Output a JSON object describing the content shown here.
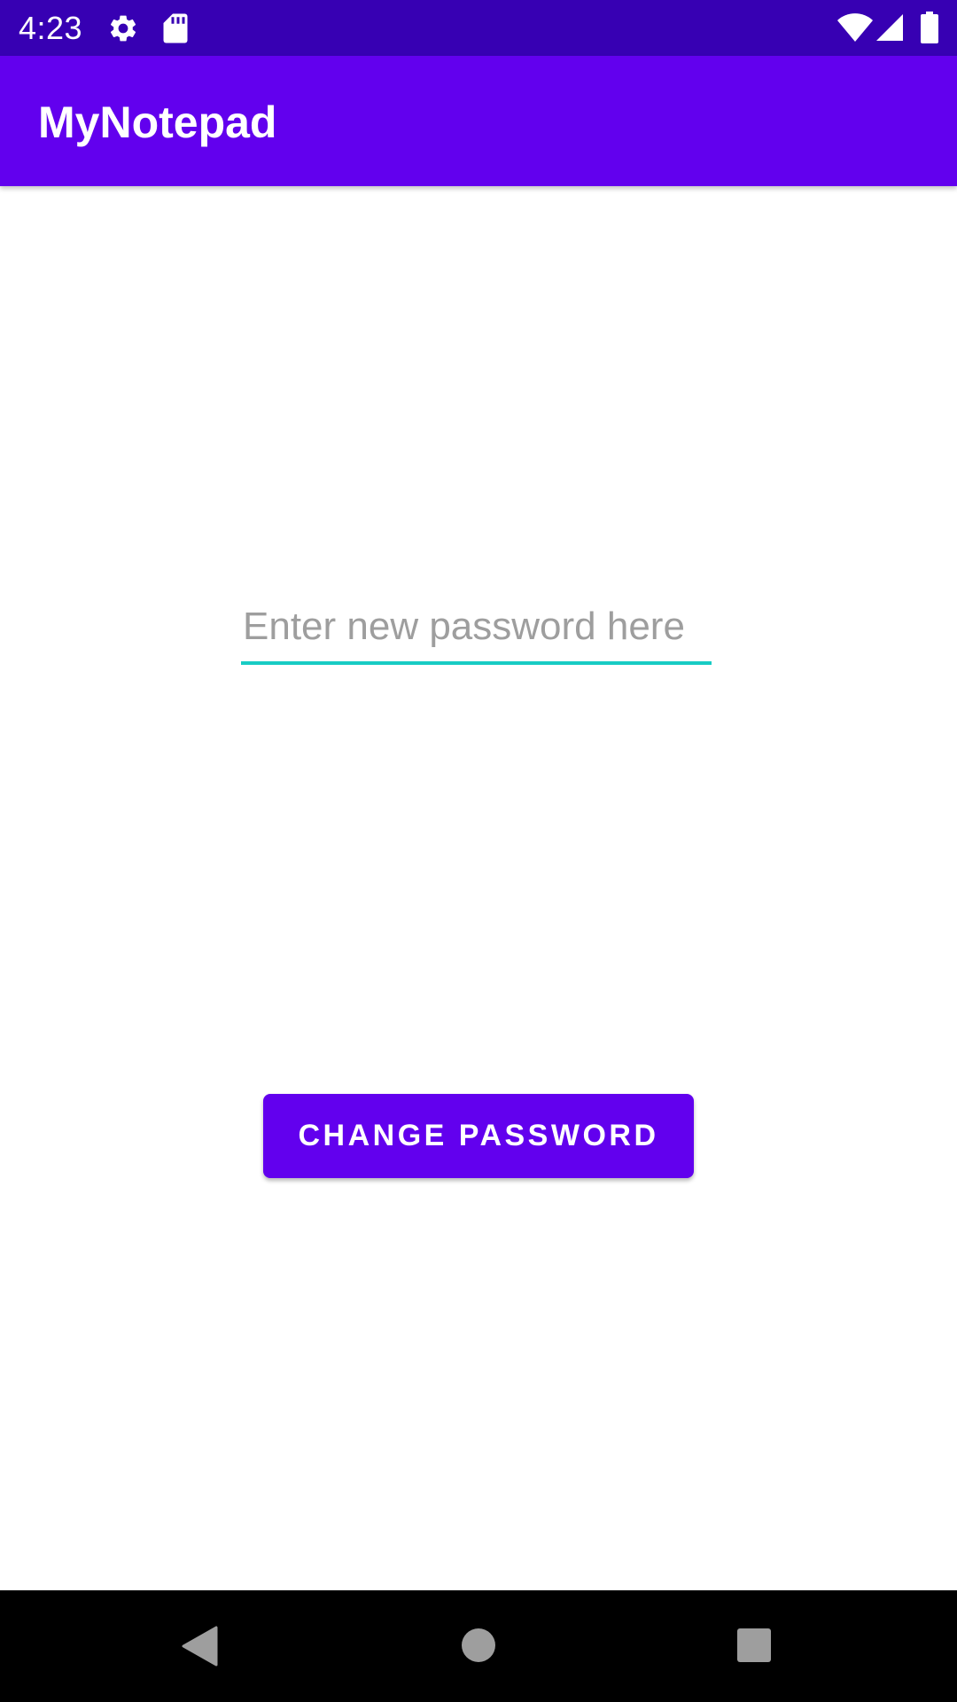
{
  "status_bar": {
    "time": "4:23",
    "icons": [
      "settings-icon",
      "sd-card-icon",
      "wifi-icon",
      "cell-signal-icon",
      "battery-icon"
    ]
  },
  "app_bar": {
    "title": "MyNotepad"
  },
  "form": {
    "password_placeholder": "Enter new password here",
    "password_value": "",
    "change_button_label": "CHANGE PASSWORD"
  },
  "nav_bar": {
    "buttons": [
      "back-icon",
      "home-icon",
      "recents-icon"
    ]
  },
  "colors": {
    "status_bar": "#3700B3",
    "primary": "#6200EE",
    "accent_underline": "#18CCC4",
    "hint_text": "#9E9E9E",
    "nav_bar": "#000000",
    "nav_icon": "#9E9E9E"
  }
}
